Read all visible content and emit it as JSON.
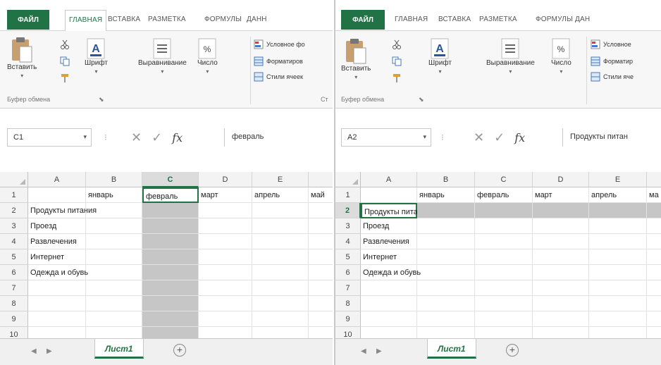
{
  "left": {
    "ribbon": {
      "file_tab": "ФАЙЛ",
      "tabs": [
        "ГЛАВНАЯ",
        "ВСТАВКА",
        "РАЗМЕТКА",
        "ФОРМУЛЫ",
        "ДАНН"
      ],
      "paste_label": "Вставить",
      "font_label": "Шрифт",
      "align_label": "Выравнивание",
      "number_label": "Число",
      "cond_format": "Условное фо",
      "format_table": "Форматиров",
      "cell_styles": "Стили ячеек",
      "clipboard_group": "Буфер обмена",
      "styles_group": "Ст"
    },
    "namebox": "C1",
    "formula_value": "февраль",
    "columns": [
      "A",
      "B",
      "C",
      "D",
      "E",
      ""
    ],
    "rows": [
      "1",
      "2",
      "3",
      "4",
      "5",
      "6",
      "7",
      "8",
      "9",
      "10"
    ],
    "row1": [
      "",
      "январь",
      "февраль",
      "март",
      "апрель",
      "май"
    ],
    "col_a": [
      "",
      "Продукты питания",
      "Проезд",
      "Развлечения",
      "Интернет",
      "Одежда и обувь",
      "",
      "",
      "",
      ""
    ],
    "sheet_tab": "Лист1",
    "add_sheet": "+"
  },
  "right": {
    "ribbon": {
      "file_tab": "ФАЙЛ",
      "tabs": [
        "ГЛАВНАЯ",
        "ВСТАВКА",
        "РАЗМЕТКА",
        "ФОРМУЛЫ",
        "ДАН"
      ],
      "paste_label": "Вставить",
      "font_label": "Шрифт",
      "align_label": "Выравнивание",
      "number_label": "Число",
      "cond_format": "Условное",
      "format_table": "Форматир",
      "cell_styles": "Стили яче",
      "clipboard_group": "Буфер обмена"
    },
    "namebox": "A2",
    "formula_value": "Продукты питан",
    "columns": [
      "A",
      "B",
      "C",
      "D",
      "E",
      ""
    ],
    "rows": [
      "1",
      "2",
      "3",
      "4",
      "5",
      "6",
      "7",
      "8",
      "9",
      "10"
    ],
    "row1": [
      "",
      "январь",
      "февраль",
      "март",
      "апрель",
      "ма"
    ],
    "col_a": [
      "",
      "Продукты питания",
      "Проезд",
      "Развлечения",
      "Интернет",
      "Одежда и обувь",
      "",
      "",
      "",
      ""
    ],
    "sheet_tab": "Лист1",
    "add_sheet": "+"
  },
  "colors": {
    "accent": "#217346",
    "selection_fill": "#c6c6c6"
  },
  "icons": {
    "paste": "clipboard-icon",
    "cut": "scissors-icon",
    "copy": "copy-icon",
    "format_painter": "brush-icon",
    "font": "font-a-icon",
    "align": "align-icon",
    "number": "percent-icon",
    "cancel": "x-icon",
    "enter": "check-icon",
    "fx": "fx-icon"
  }
}
